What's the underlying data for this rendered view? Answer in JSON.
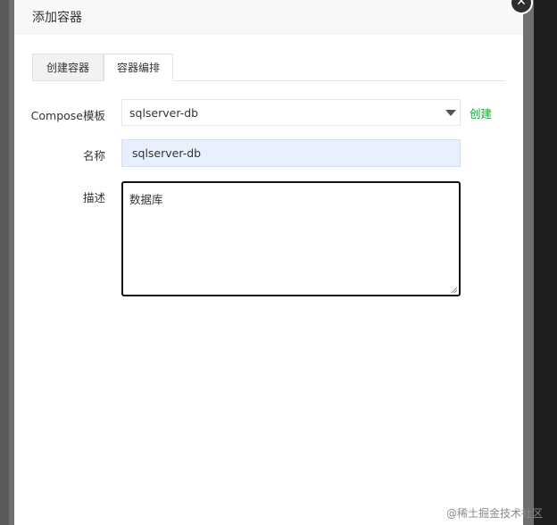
{
  "dialog": {
    "title": "添加容器",
    "close_symbol": "✕"
  },
  "tabs": [
    {
      "label": "创建容器",
      "active": false
    },
    {
      "label": "容器编排",
      "active": true
    }
  ],
  "form": {
    "compose_label": "Compose模板",
    "compose_value": "sqlserver-db",
    "create_link": "创建",
    "name_label": "名称",
    "name_value": "sqlserver-db",
    "desc_label": "描述",
    "desc_value": "数据库"
  },
  "watermark": "@稀土掘金技术社区",
  "colors": {
    "link": "#1aa33a",
    "autofill_bg": "#e8f0fe",
    "focus_border": "#111111"
  }
}
